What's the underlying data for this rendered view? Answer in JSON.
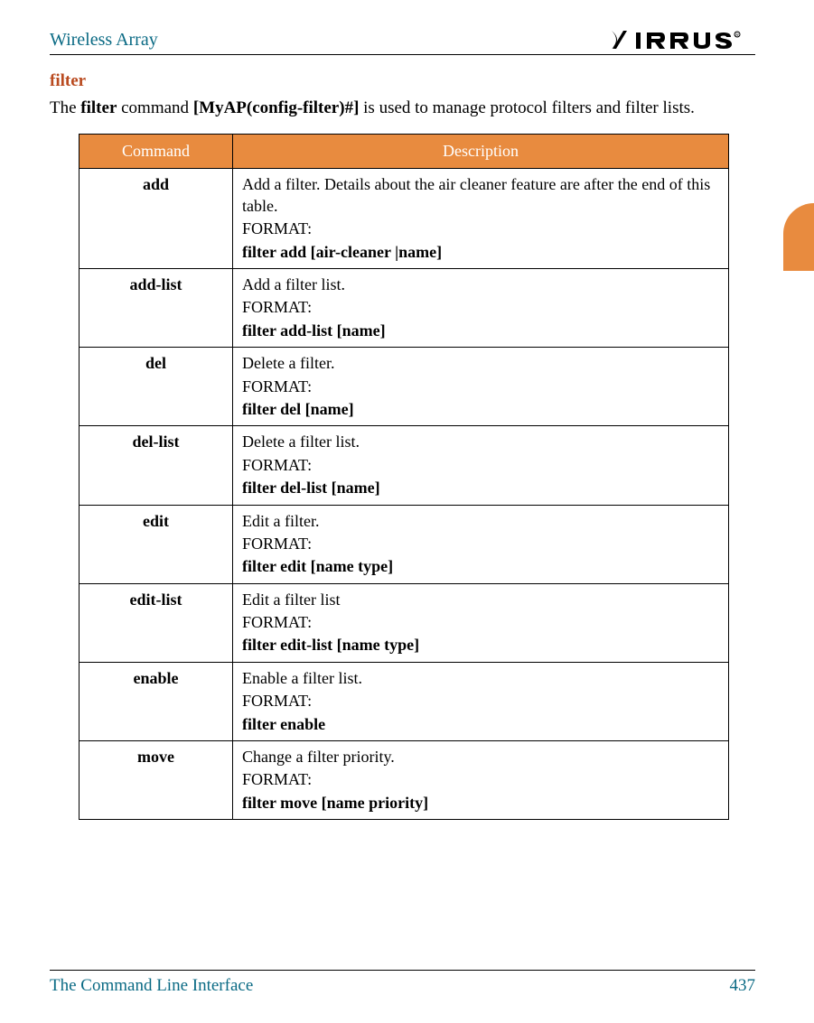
{
  "header": {
    "title": "Wireless Array",
    "brand": "XIRRUS"
  },
  "section": {
    "title": "filter",
    "intro_pre": "The ",
    "intro_cmd": "filter",
    "intro_mid": " command ",
    "intro_prompt": "[MyAP(config-filter)#]",
    "intro_post": " is used to manage protocol filters and filter lists."
  },
  "table": {
    "headers": {
      "col1": "Command",
      "col2": "Description"
    },
    "rows": [
      {
        "cmd": "add",
        "desc": "Add a filter. Details about the air cleaner feature are after the end of this table.",
        "format_label": "FORMAT:",
        "format_cmd": "filter add [air-cleaner |name]"
      },
      {
        "cmd": "add-list",
        "desc": "Add a filter list.",
        "format_label": "FORMAT:",
        "format_cmd": "filter add-list [name]"
      },
      {
        "cmd": "del",
        "desc": "Delete a filter.",
        "format_label": "FORMAT:",
        "format_cmd": "filter del [name]"
      },
      {
        "cmd": "del-list",
        "desc": "Delete a filter list.",
        "format_label": "FORMAT:",
        "format_cmd": "filter del-list [name]"
      },
      {
        "cmd": "edit",
        "desc": "Edit a filter.",
        "format_label": "FORMAT:",
        "format_cmd": "filter edit [name type]"
      },
      {
        "cmd": "edit-list",
        "desc": "Edit a filter list",
        "format_label": "FORMAT:",
        "format_cmd": "filter edit-list [name type]"
      },
      {
        "cmd": "enable",
        "desc": "Enable a filter list.",
        "format_label": "FORMAT:",
        "format_cmd": "filter enable"
      },
      {
        "cmd": "move",
        "desc": "Change a filter priority.",
        "format_label": "FORMAT:",
        "format_cmd": "filter move [name priority]"
      }
    ]
  },
  "footer": {
    "section": "The Command Line Interface",
    "page": "437"
  }
}
